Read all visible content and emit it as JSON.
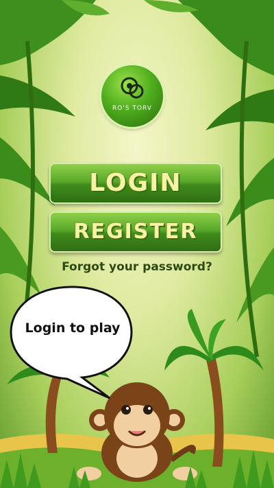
{
  "logo": {
    "text": "RO'S TORV"
  },
  "buttons": {
    "login": "LOGIN",
    "register": "REGISTER"
  },
  "forgot": {
    "text": "Forgot your password?"
  },
  "bubble": {
    "text": "Login to play"
  }
}
